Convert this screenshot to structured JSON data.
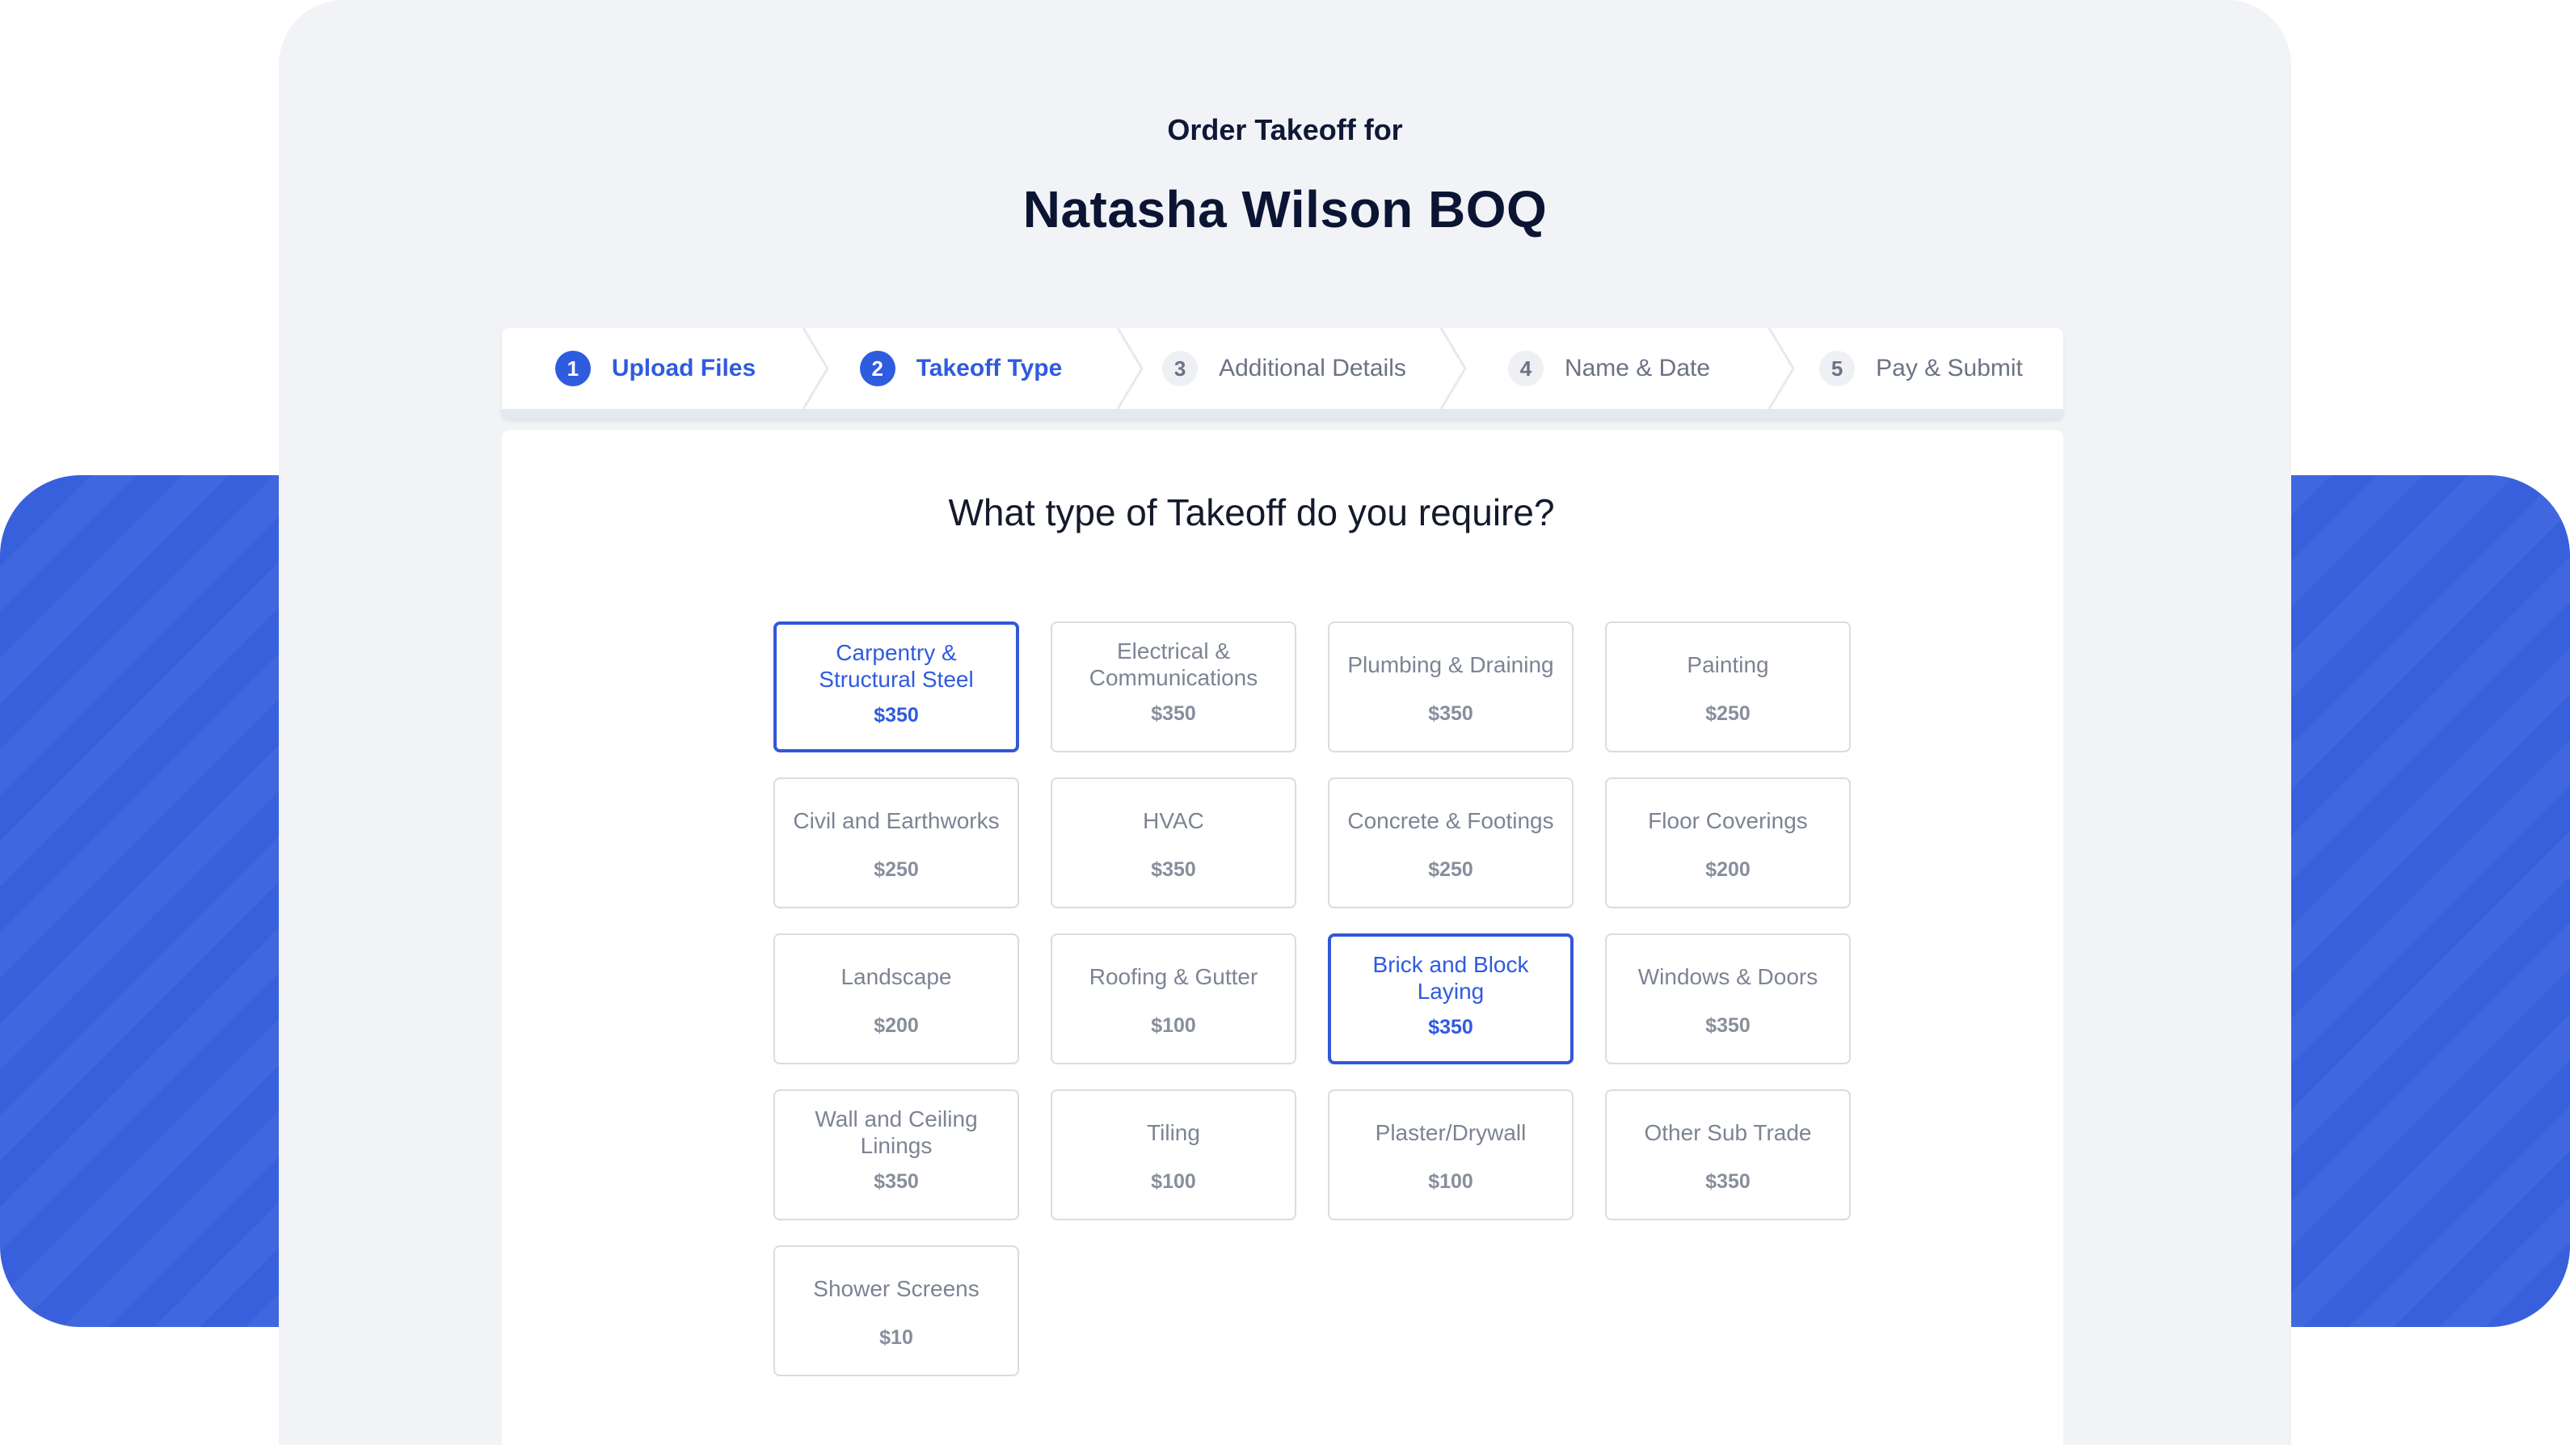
{
  "header": {
    "subtitle": "Order Takeoff for",
    "title": "Natasha Wilson BOQ"
  },
  "steps": [
    {
      "num": "1",
      "label": "Upload Files",
      "state": "done"
    },
    {
      "num": "2",
      "label": "Takeoff Type",
      "state": "active"
    },
    {
      "num": "3",
      "label": "Additional Details",
      "state": "pending"
    },
    {
      "num": "4",
      "label": "Name & Date",
      "state": "pending"
    },
    {
      "num": "5",
      "label": "Pay & Submit",
      "state": "pending"
    }
  ],
  "question": "What type of Takeoff do you require?",
  "options": [
    {
      "name": "Carpentry & Structural Steel",
      "price": "$350",
      "selected": true
    },
    {
      "name": "Electrical & Communications",
      "price": "$350",
      "selected": false
    },
    {
      "name": "Plumbing & Draining",
      "price": "$350",
      "selected": false
    },
    {
      "name": "Painting",
      "price": "$250",
      "selected": false
    },
    {
      "name": "Civil and Earthworks",
      "price": "$250",
      "selected": false
    },
    {
      "name": "HVAC",
      "price": "$350",
      "selected": false
    },
    {
      "name": "Concrete & Footings",
      "price": "$250",
      "selected": false
    },
    {
      "name": "Floor Coverings",
      "price": "$200",
      "selected": false
    },
    {
      "name": "Landscape",
      "price": "$200",
      "selected": false
    },
    {
      "name": "Roofing & Gutter",
      "price": "$100",
      "selected": false
    },
    {
      "name": "Brick and Block Laying",
      "price": "$350",
      "selected": true
    },
    {
      "name": "Windows & Doors",
      "price": "$350",
      "selected": false
    },
    {
      "name": "Wall and Ceiling Linings",
      "price": "$350",
      "selected": false
    },
    {
      "name": "Tiling",
      "price": "$100",
      "selected": false
    },
    {
      "name": "Plaster/Drywall",
      "price": "$100",
      "selected": false
    },
    {
      "name": "Other Sub Trade",
      "price": "$350",
      "selected": false
    },
    {
      "name": "Shower Screens",
      "price": "$10",
      "selected": false
    }
  ],
  "colors": {
    "accent": "#2f5bdf",
    "band": "#3860dc",
    "panel": "#f1f3f7"
  }
}
